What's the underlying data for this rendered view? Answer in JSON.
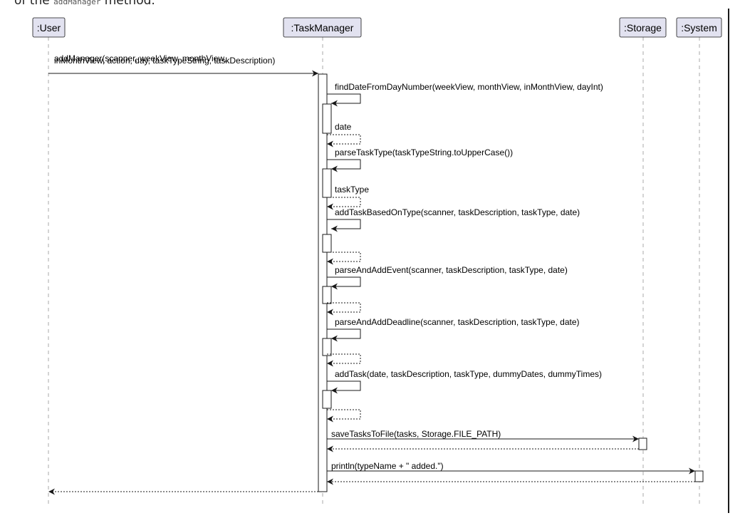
{
  "caption": {
    "prefix": "of the",
    "code": "addManager",
    "suffix": "method."
  },
  "participants": [
    {
      "id": "user",
      "label": ":User"
    },
    {
      "id": "taskmanager",
      "label": ":TaskManager"
    },
    {
      "id": "storage",
      "label": ":Storage"
    },
    {
      "id": "system",
      "label": ":System"
    }
  ],
  "messages": [
    {
      "kind": "call",
      "from": "user",
      "to": "taskmanager",
      "lines": [
        "addManager(scanner, weekView, monthView,",
        " inMonthView, action, day, taskTypeString, taskDescription)"
      ]
    },
    {
      "kind": "self",
      "lines": [
        "findDateFromDayNumber(weekView, monthView, inMonthView, dayInt)"
      ]
    },
    {
      "kind": "self-return",
      "lines": [
        "date"
      ]
    },
    {
      "kind": "self",
      "lines": [
        "parseTaskType(taskTypeString.toUpperCase())"
      ]
    },
    {
      "kind": "self-return",
      "lines": [
        "taskType"
      ]
    },
    {
      "kind": "self",
      "lines": [
        "addTaskBasedOnType(scanner, taskDescription, taskType, date)"
      ]
    },
    {
      "kind": "self-return",
      "lines": []
    },
    {
      "kind": "self",
      "lines": [
        "parseAndAddEvent(scanner, taskDescription, taskType, date)"
      ]
    },
    {
      "kind": "self-return",
      "lines": []
    },
    {
      "kind": "self",
      "lines": [
        "parseAndAddDeadline(scanner, taskDescription, taskType, date)"
      ]
    },
    {
      "kind": "self-return",
      "lines": []
    },
    {
      "kind": "self",
      "lines": [
        "addTask(date, taskDescription, taskType, dummyDates, dummyTimes)"
      ]
    },
    {
      "kind": "self-return",
      "lines": []
    },
    {
      "kind": "call",
      "from": "taskmanager",
      "to": "storage",
      "lines": [
        "saveTasksToFile(tasks, Storage.FILE_PATH)"
      ]
    },
    {
      "kind": "return",
      "from": "storage",
      "to": "taskmanager",
      "lines": []
    },
    {
      "kind": "call",
      "from": "taskmanager",
      "to": "system",
      "lines": [
        "println(typeName + \" added.\")"
      ]
    },
    {
      "kind": "return",
      "from": "system",
      "to": "taskmanager",
      "lines": []
    },
    {
      "kind": "return",
      "from": "taskmanager",
      "to": "user",
      "lines": []
    }
  ]
}
